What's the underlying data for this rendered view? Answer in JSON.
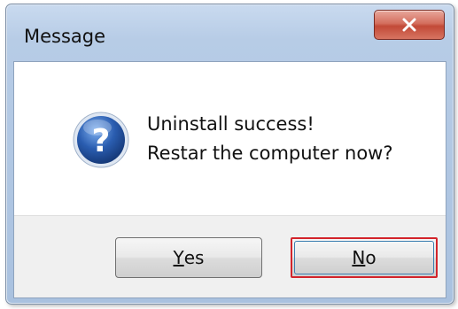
{
  "window": {
    "title": "Message",
    "close_icon": "close-icon"
  },
  "message": {
    "icon": "question-icon",
    "line1": "Uninstall success!",
    "line2": "Restar the computer now?"
  },
  "buttons": {
    "yes": {
      "mnemonic": "Y",
      "rest": "es"
    },
    "no": {
      "mnemonic": "N",
      "rest": "o"
    }
  },
  "colors": {
    "close_button": "#c94c3a",
    "highlight_border": "#d3242b",
    "question_icon": "#2a5db0"
  }
}
